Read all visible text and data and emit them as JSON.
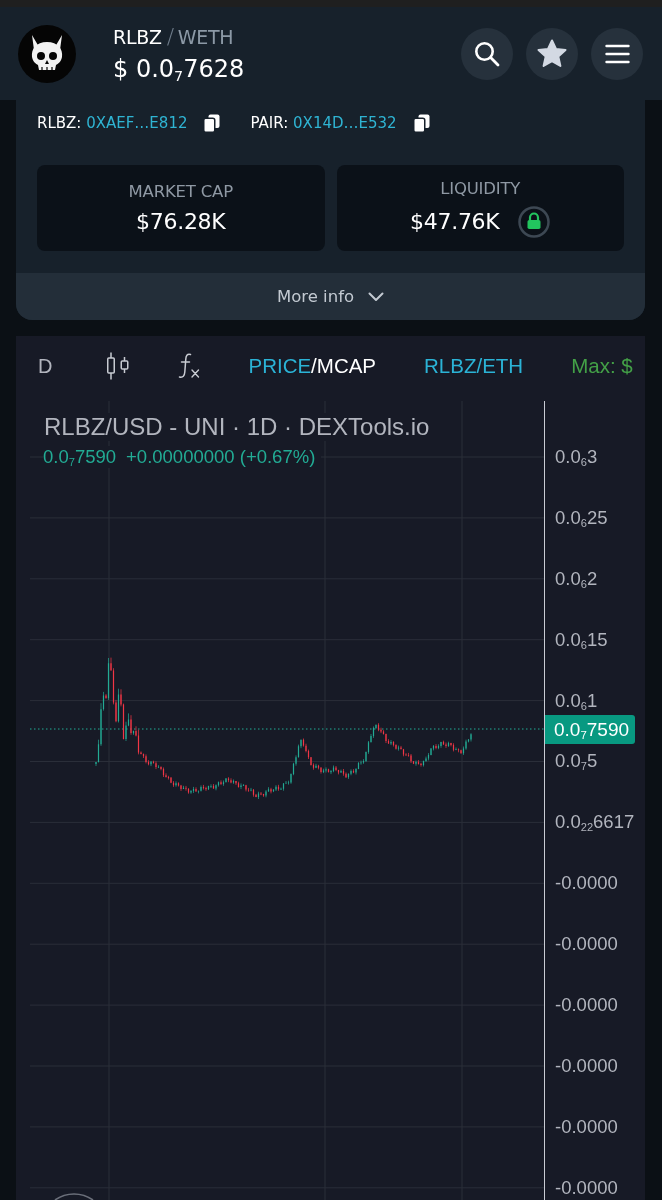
{
  "header": {
    "pair": {
      "base": "RLBZ",
      "separator": "/",
      "quote": "WETH"
    },
    "price": "$ 0.0$_{7}$7628",
    "buttons": [
      {
        "kind": "search"
      },
      {
        "kind": "favorite"
      },
      {
        "kind": "menu"
      }
    ]
  },
  "addresses": [
    {
      "label": "RLBZ:",
      "value": "0XAEF…E812"
    },
    {
      "label": "PAIR:",
      "value": "0X14D…E532"
    }
  ],
  "stats": [
    {
      "label": "MARKET CAP",
      "value": "$76.28K",
      "locked": false
    },
    {
      "label": "LIQUIDITY",
      "value": "$47.76K",
      "locked": true
    }
  ],
  "more_info": {
    "label": "More info",
    "expanded": false
  },
  "chart_toolbar": {
    "interval": "D",
    "tools": [
      {
        "kind": "candles"
      },
      {
        "kind": "indicators"
      }
    ],
    "mode_options": [
      {
        "label": "PRICE",
        "selected": true
      },
      {
        "label": "MCAP",
        "selected": false
      }
    ],
    "mode_separator": "/",
    "pair": "RLBZ/ETH",
    "max_label": "Max: $"
  },
  "chart": {
    "legend": {
      "title": "RLBZ/USD - UNI · 1D · DEXTools.io",
      "last": "0.0$_{7}$7590",
      "change": "+0.00000000 (+0.67%)"
    },
    "price_axis": [
      "0.0$_{6}$3",
      "0.0$_{6}$25",
      "0.0$_{6}$2",
      "0.0$_{6}$15",
      "0.0$_{6}$1",
      "0.0$_{7}$5",
      "0.0$_{22}$6617",
      "-0.0000",
      "-0.0000",
      "-0.0000",
      "-0.0000",
      "-0.0000",
      "-0.0000"
    ],
    "last_price_tag": "0.0$_{7}$7590"
  }
}
